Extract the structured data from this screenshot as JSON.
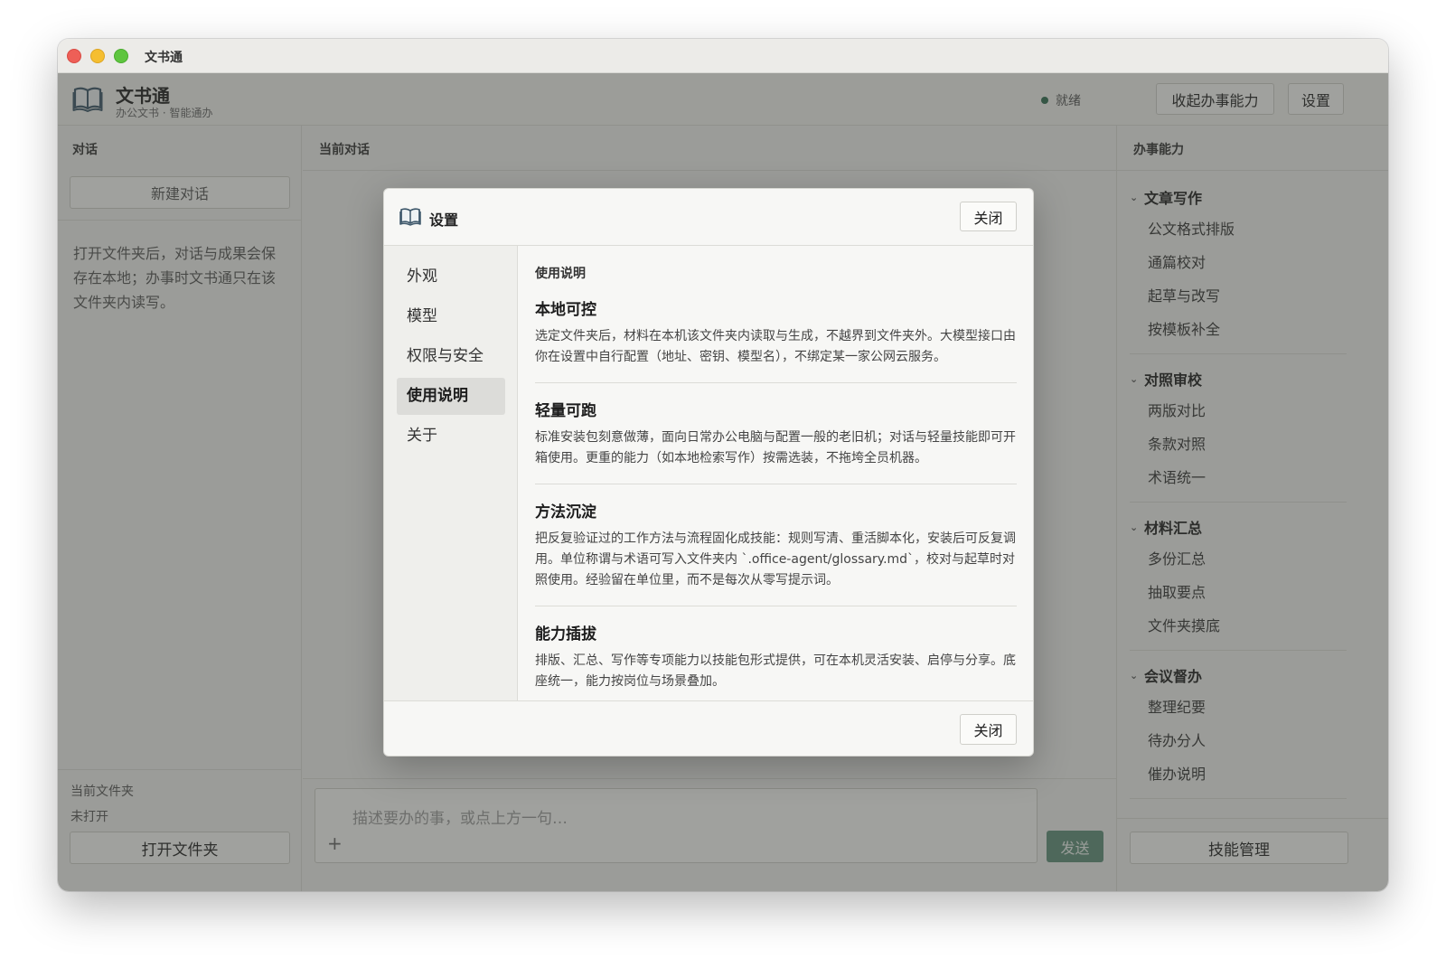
{
  "window": {
    "title": "文书通"
  },
  "app": {
    "name": "文书通",
    "subtitle": "办公文书 · 智能通办",
    "status": "就绪",
    "collapse_label": "收起办事能力",
    "settings_label": "设置"
  },
  "left_panel": {
    "header": "对话",
    "new_chat": "新建对话",
    "hint": "打开文件夹后，对话与成果会保存在本地；办事时文书通只在该文件夹内读写。",
    "folder_label": "当前文件夹",
    "folder_value": "未打开",
    "open_folder": "打开文件夹"
  },
  "center_panel": {
    "header": "当前对话",
    "input_placeholder": "描述要办的事，或点上方一句…",
    "plus": "+",
    "send": "发送"
  },
  "right_panel": {
    "header": "办事能力",
    "groups": [
      {
        "title": "文章写作",
        "items": [
          "公文格式排版",
          "通篇校对",
          "起草与改写",
          "按模板补全"
        ]
      },
      {
        "title": "对照审校",
        "items": [
          "两版对比",
          "条款对照",
          "术语统一"
        ]
      },
      {
        "title": "材料汇总",
        "items": [
          "多份汇总",
          "抽取要点",
          "文件夹摸底"
        ]
      },
      {
        "title": "会议督办",
        "items": [
          "整理纪要",
          "待办分人",
          "催办说明"
        ]
      }
    ],
    "skill_manage": "技能管理"
  },
  "dialog": {
    "title": "设置",
    "close_label": "关闭",
    "nav": [
      {
        "label": "外观"
      },
      {
        "label": "模型"
      },
      {
        "label": "权限与安全"
      },
      {
        "label": "使用说明",
        "active": true
      },
      {
        "label": "关于"
      }
    ],
    "content_heading": "使用说明",
    "sections": [
      {
        "title": "本地可控",
        "body": "选定文件夹后，材料在本机该文件夹内读取与生成，不越界到文件夹外。大模型接口由你在设置中自行配置（地址、密钥、模型名），不绑定某一家公网云服务。"
      },
      {
        "title": "轻量可跑",
        "body": "标准安装包刻意做薄，面向日常办公电脑与配置一般的老旧机；对话与轻量技能即可开箱使用。更重的能力（如本地检索写作）按需选装，不拖垮全员机器。"
      },
      {
        "title": "方法沉淀",
        "body": "把反复验证过的工作方法与流程固化成技能：规则写清、重活脚本化，安装后可反复调用。单位称谓与术语可写入文件夹内 `.office-agent/glossary.md`，校对与起草时对照使用。经验留在单位里，而不是每次从零写提示词。"
      },
      {
        "title": "能力插拔",
        "body": "排版、汇总、写作等专项能力以技能包形式提供，可在本机灵活安装、启停与分享。底座统一，能力按岗位与场景叠加。"
      }
    ]
  },
  "colors": {
    "accent": "#5f8f79",
    "status_dot": "#2f6b4f",
    "overlay": "rgba(60,62,58,0.48)"
  },
  "icons": {
    "app_logo": "open-book-icon",
    "dialog_logo": "open-book-icon",
    "group_toggle": "chevron-down-icon"
  }
}
